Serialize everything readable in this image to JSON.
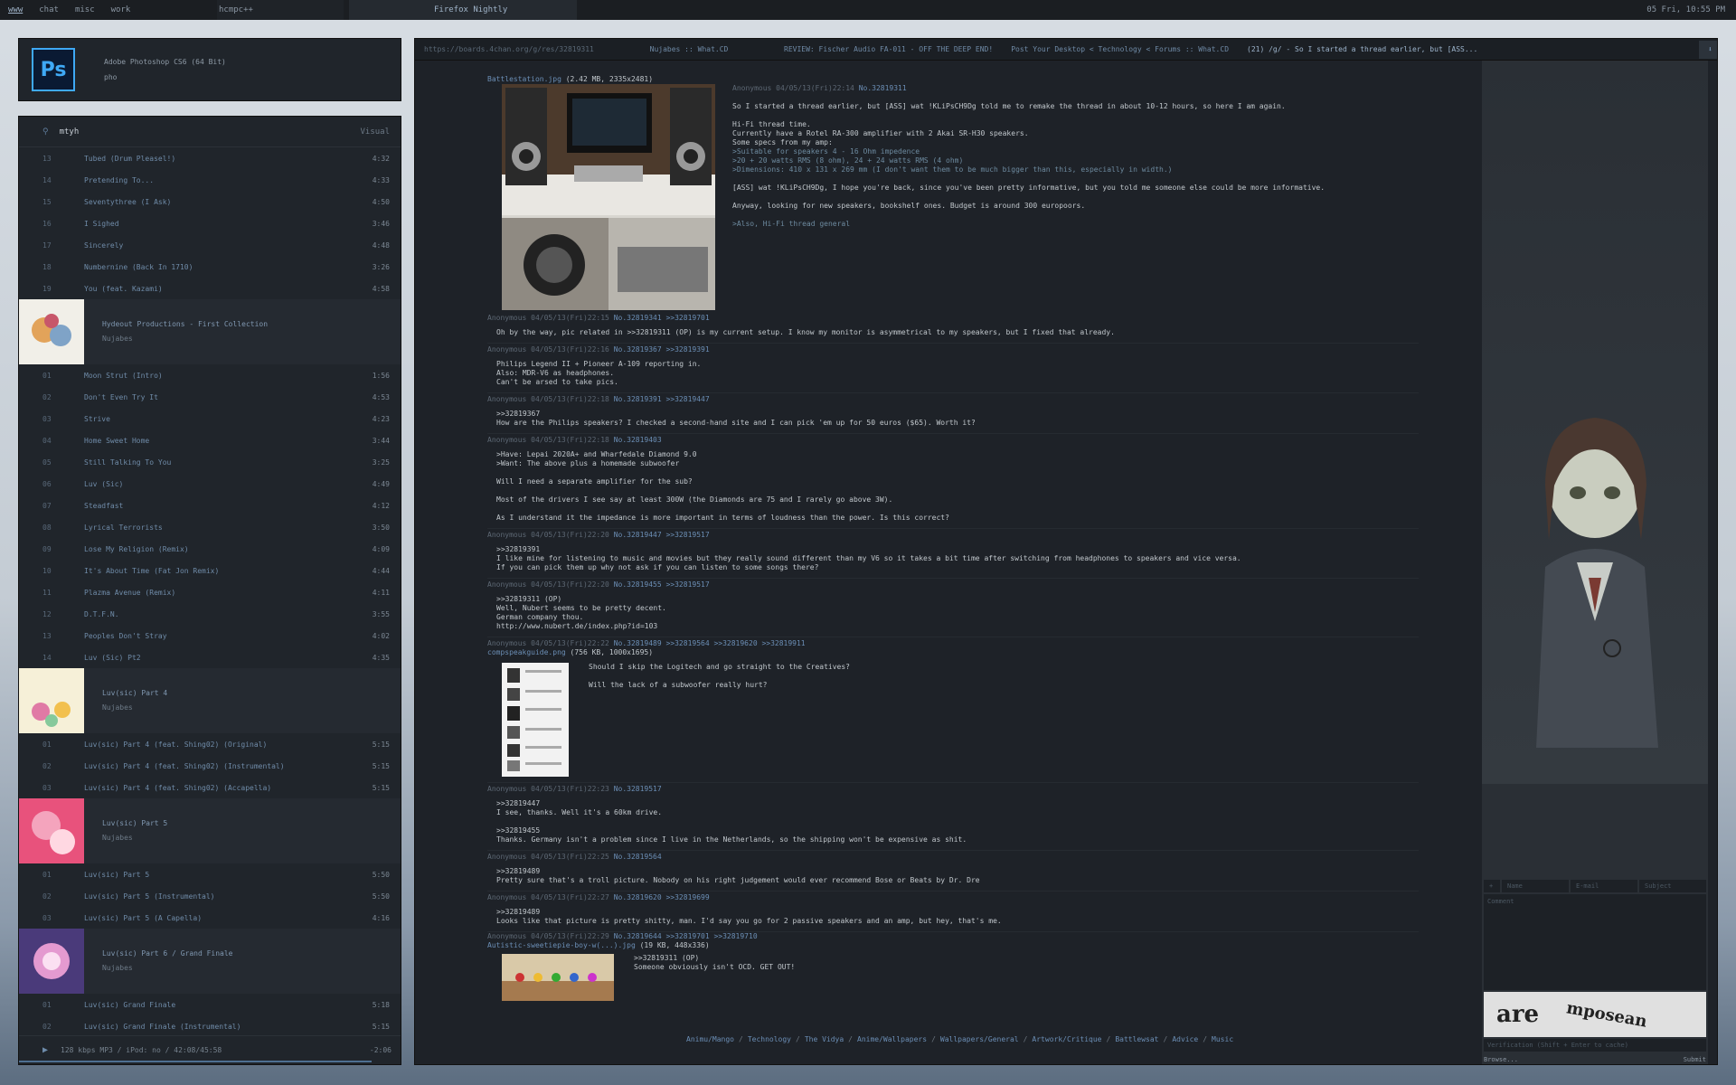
{
  "topbar": {
    "workspaces": [
      "www",
      "chat",
      "misc",
      "work"
    ],
    "active_workspace": "www",
    "windows": [
      "hcmpc++",
      "Firefox Nightly"
    ],
    "clock": "05 Fri, 10:55 PM"
  },
  "photoshop": {
    "title": "Adobe Photoshop CS6 (64 Bit)",
    "subtitle": "pho",
    "icon": "Ps"
  },
  "player": {
    "search_query": "mtyh",
    "mode": "Visual",
    "tracks_a": [
      {
        "n": "13",
        "t": "Tubed (Drum Pleasel!)",
        "d": "4:32"
      },
      {
        "n": "14",
        "t": "Pretending To...",
        "d": "4:33"
      },
      {
        "n": "15",
        "t": "Seventythree (I Ask)",
        "d": "4:50"
      },
      {
        "n": "16",
        "t": "I Sighed",
        "d": "3:46"
      },
      {
        "n": "17",
        "t": "Sincerely",
        "d": "4:48"
      },
      {
        "n": "18",
        "t": "Numbernine (Back In 1710)",
        "d": "3:26"
      },
      {
        "n": "19",
        "t": "You (feat. Kazami)",
        "d": "4:58"
      }
    ],
    "album1": {
      "title": "Hydeout Productions - First Collection",
      "artist": "Nujabes"
    },
    "tracks_b": [
      {
        "n": "01",
        "t": "Moon Strut (Intro)",
        "d": "1:56"
      },
      {
        "n": "02",
        "t": "Don't Even Try It",
        "d": "4:53"
      },
      {
        "n": "03",
        "t": "Strive",
        "d": "4:23"
      },
      {
        "n": "04",
        "t": "Home Sweet Home",
        "d": "3:44"
      },
      {
        "n": "05",
        "t": "Still Talking To You",
        "d": "3:25"
      },
      {
        "n": "06",
        "t": "Luv (Sic)",
        "d": "4:49"
      },
      {
        "n": "07",
        "t": "Steadfast",
        "d": "4:12"
      },
      {
        "n": "08",
        "t": "Lyrical Terrorists",
        "d": "3:50"
      },
      {
        "n": "09",
        "t": "Lose My Religion (Remix)",
        "d": "4:09"
      },
      {
        "n": "10",
        "t": "It's About Time (Fat Jon Remix)",
        "d": "4:44"
      },
      {
        "n": "11",
        "t": "Plazma Avenue (Remix)",
        "d": "4:11"
      },
      {
        "n": "12",
        "t": "D.T.F.N.",
        "d": "3:55"
      },
      {
        "n": "13",
        "t": "Peoples Don't Stray",
        "d": "4:02"
      },
      {
        "n": "14",
        "t": "Luv (Sic) Pt2",
        "d": "4:35"
      }
    ],
    "album2": {
      "title": "Luv(sic) Part 4",
      "artist": "Nujabes"
    },
    "tracks_c": [
      {
        "n": "01",
        "t": "Luv(sic) Part 4 (feat. Shing02) (Original)",
        "d": "5:15"
      },
      {
        "n": "02",
        "t": "Luv(sic) Part 4 (feat. Shing02) (Instrumental)",
        "d": "5:15"
      },
      {
        "n": "03",
        "t": "Luv(sic) Part 4 (feat. Shing02) (Accapella)",
        "d": "5:15"
      }
    ],
    "album3": {
      "title": "Luv(sic) Part 5",
      "artist": "Nujabes"
    },
    "tracks_d": [
      {
        "n": "01",
        "t": "Luv(sic) Part 5",
        "d": "5:50"
      },
      {
        "n": "02",
        "t": "Luv(sic) Part 5 (Instrumental)",
        "d": "5:50"
      },
      {
        "n": "03",
        "t": "Luv(sic) Part 5 (A Capella)",
        "d": "4:16"
      }
    ],
    "album4": {
      "title": "Luv(sic) Part 6 / Grand Finale",
      "artist": "Nujabes"
    },
    "tracks_e": [
      {
        "n": "01",
        "t": "Luv(sic) Grand Finale",
        "d": "5:18"
      },
      {
        "n": "02",
        "t": "Luv(sic) Grand Finale (Instrumental)",
        "d": "5:15"
      }
    ],
    "status": "128 kbps MP3 / iPod: no / 42:08/45:58",
    "remaining": "-2:06",
    "progress": 0.92
  },
  "browser": {
    "url": "https://boards.4chan.org/g/res/32819311",
    "tabs": [
      "Nujabes :: What.CD",
      "REVIEW: Fischer Audio FA-011 - OFF THE DEEP END!",
      "Post Your Desktop < Technology < Forums :: What.CD",
      "(21) /g/ - So I started a thread earlier, but [ASS..."
    ],
    "active_tab": 3,
    "op": {
      "file": "Battlestation.jpg",
      "fileinfo": "(2.42 MB, 2335x2481)",
      "meta": "Anonymous 04/05/13(Fri)22:14",
      "no": "No.32819311",
      "lines": [
        "So I started a thread earlier, but [ASS] wat !KLiPsCH9Dg told me to remake the thread in about 10-12 hours, so here I am again.",
        "",
        "Hi-Fi thread time.",
        "Currently have a Rotel RA-300 amplifier with 2 Akai SR-H30 speakers.",
        "Some specs from my amp:",
        ">Suitable for speakers 4 - 16 Ohm impedence",
        ">20 + 20 watts RMS (8 ohm), 24 + 24 watts RMS (4 ohm)",
        ">Dimensions: 410 x 131 x 269 mm (I don't want them to be much bigger than this, especially in width.)",
        "",
        "[ASS] wat !KLiPsCH9Dg, I hope you're back, since you've been pretty informative, but you told me someone else could be more informative.",
        "",
        "Anyway, looking for new speakers, bookshelf ones. Budget is around 300 europoors.",
        "",
        ">Also, Hi-Fi thread general"
      ]
    },
    "replies": [
      {
        "meta": "Anonymous 04/05/13(Fri)22:15",
        "no": "No.32819341 >>32819701",
        "body": "Oh by the way, pic related in >>32819311 (OP) is my current setup. I know my monitor is asymmetrical to my speakers, but I fixed that already."
      },
      {
        "meta": "Anonymous 04/05/13(Fri)22:16",
        "no": "No.32819367 >>32819391",
        "body": "Philips Legend II + Pioneer A-109 reporting in.\nAlso: MDR-V6 as headphones.\nCan't be arsed to take pics."
      },
      {
        "meta": "Anonymous 04/05/13(Fri)22:18",
        "no": "No.32819391 >>32819447",
        "body": ">>32819367\nHow are the Philips speakers? I checked a second-hand site and I can pick 'em up for 50 euros ($65). Worth it?"
      },
      {
        "meta": "Anonymous 04/05/13(Fri)22:18",
        "no": "No.32819403",
        "body": ">Have: Lepai 2020A+ and Wharfedale Diamond 9.0\n>Want: The above plus a homemade subwoofer\n\nWill I need a separate amplifier for the sub?\n\nMost of the drivers I see say at least 300W (the Diamonds are 75 and I rarely go above 3W).\n\nAs I understand it the impedance is more important in terms of loudness than the power. Is this correct?"
      },
      {
        "meta": "Anonymous 04/05/13(Fri)22:20",
        "no": "No.32819447 >>32819517",
        "body": ">>32819391\nI like mine for listening to music and movies but they really sound different than my V6 so it takes a bit time after switching from headphones to speakers and vice versa.\nIf you can pick them up why not ask if you can listen to some songs there?"
      },
      {
        "meta": "Anonymous 04/05/13(Fri)22:20",
        "no": "No.32819455 >>32819517",
        "body": ">>32819311 (OP)\nWell, Nubert seems to be pretty decent.\nGerman company thou.\nhttp://www.nubert.de/index.php?id=103"
      }
    ],
    "post_img": {
      "meta": "Anonymous 04/05/13(Fri)22:22",
      "no": "No.32819489 >>32819564 >>32819620 >>32819911",
      "file": "compspeakguide.png",
      "fileinfo": "(756 KB, 1000x1695)",
      "body": "Should I skip the Logitech and go straight to the Creatives?\n\nWill the lack of a subwoofer really hurt?"
    },
    "replies2": [
      {
        "meta": "Anonymous 04/05/13(Fri)22:23",
        "no": "No.32819517",
        "body": ">>32819447\nI see, thanks. Well it's a 60km drive.\n\n>>32819455\nThanks. Germany isn't a problem since I live in the Netherlands, so the shipping won't be expensive as shit."
      },
      {
        "meta": "Anonymous 04/05/13(Fri)22:25",
        "no": "No.32819564",
        "body": ">>32819489\nPretty sure that's a troll picture. Nobody on his right judgement would ever recommend Bose or Beats by Dr. Dre"
      },
      {
        "meta": "Anonymous 04/05/13(Fri)22:27",
        "no": "No.32819620 >>32819699",
        "body": ">>32819489\nLooks like that picture is pretty shitty, man. I'd say you go for 2 passive speakers and an amp, but hey, that's me."
      }
    ],
    "last": {
      "meta": "Anonymous 04/05/13(Fri)22:29",
      "no": "No.32819644 >>32819701 >>32819710",
      "file": "Autistic-sweetiepie-boy-w(...).jpg",
      "fileinfo": "(19 KB, 448x336)",
      "body": ">>32819311 (OP)\nSomeone obviously isn't OCD. GET OUT!"
    },
    "footer": [
      "Animu/Mango",
      "Technology",
      "The Vidya",
      "Anime/Wallpapers",
      "Wallpapers/General",
      "Artwork/Critique",
      "Battlewsat",
      "Advice",
      "Music"
    ],
    "form": {
      "name": "Name",
      "email": "E-mail",
      "subject": "Subject",
      "comment": "Comment",
      "captcha_a": "are",
      "captcha_b": "mposean",
      "verification": "Verification (Shift + Enter to cache)",
      "browse": "Browse...",
      "submit": "Submit"
    }
  }
}
